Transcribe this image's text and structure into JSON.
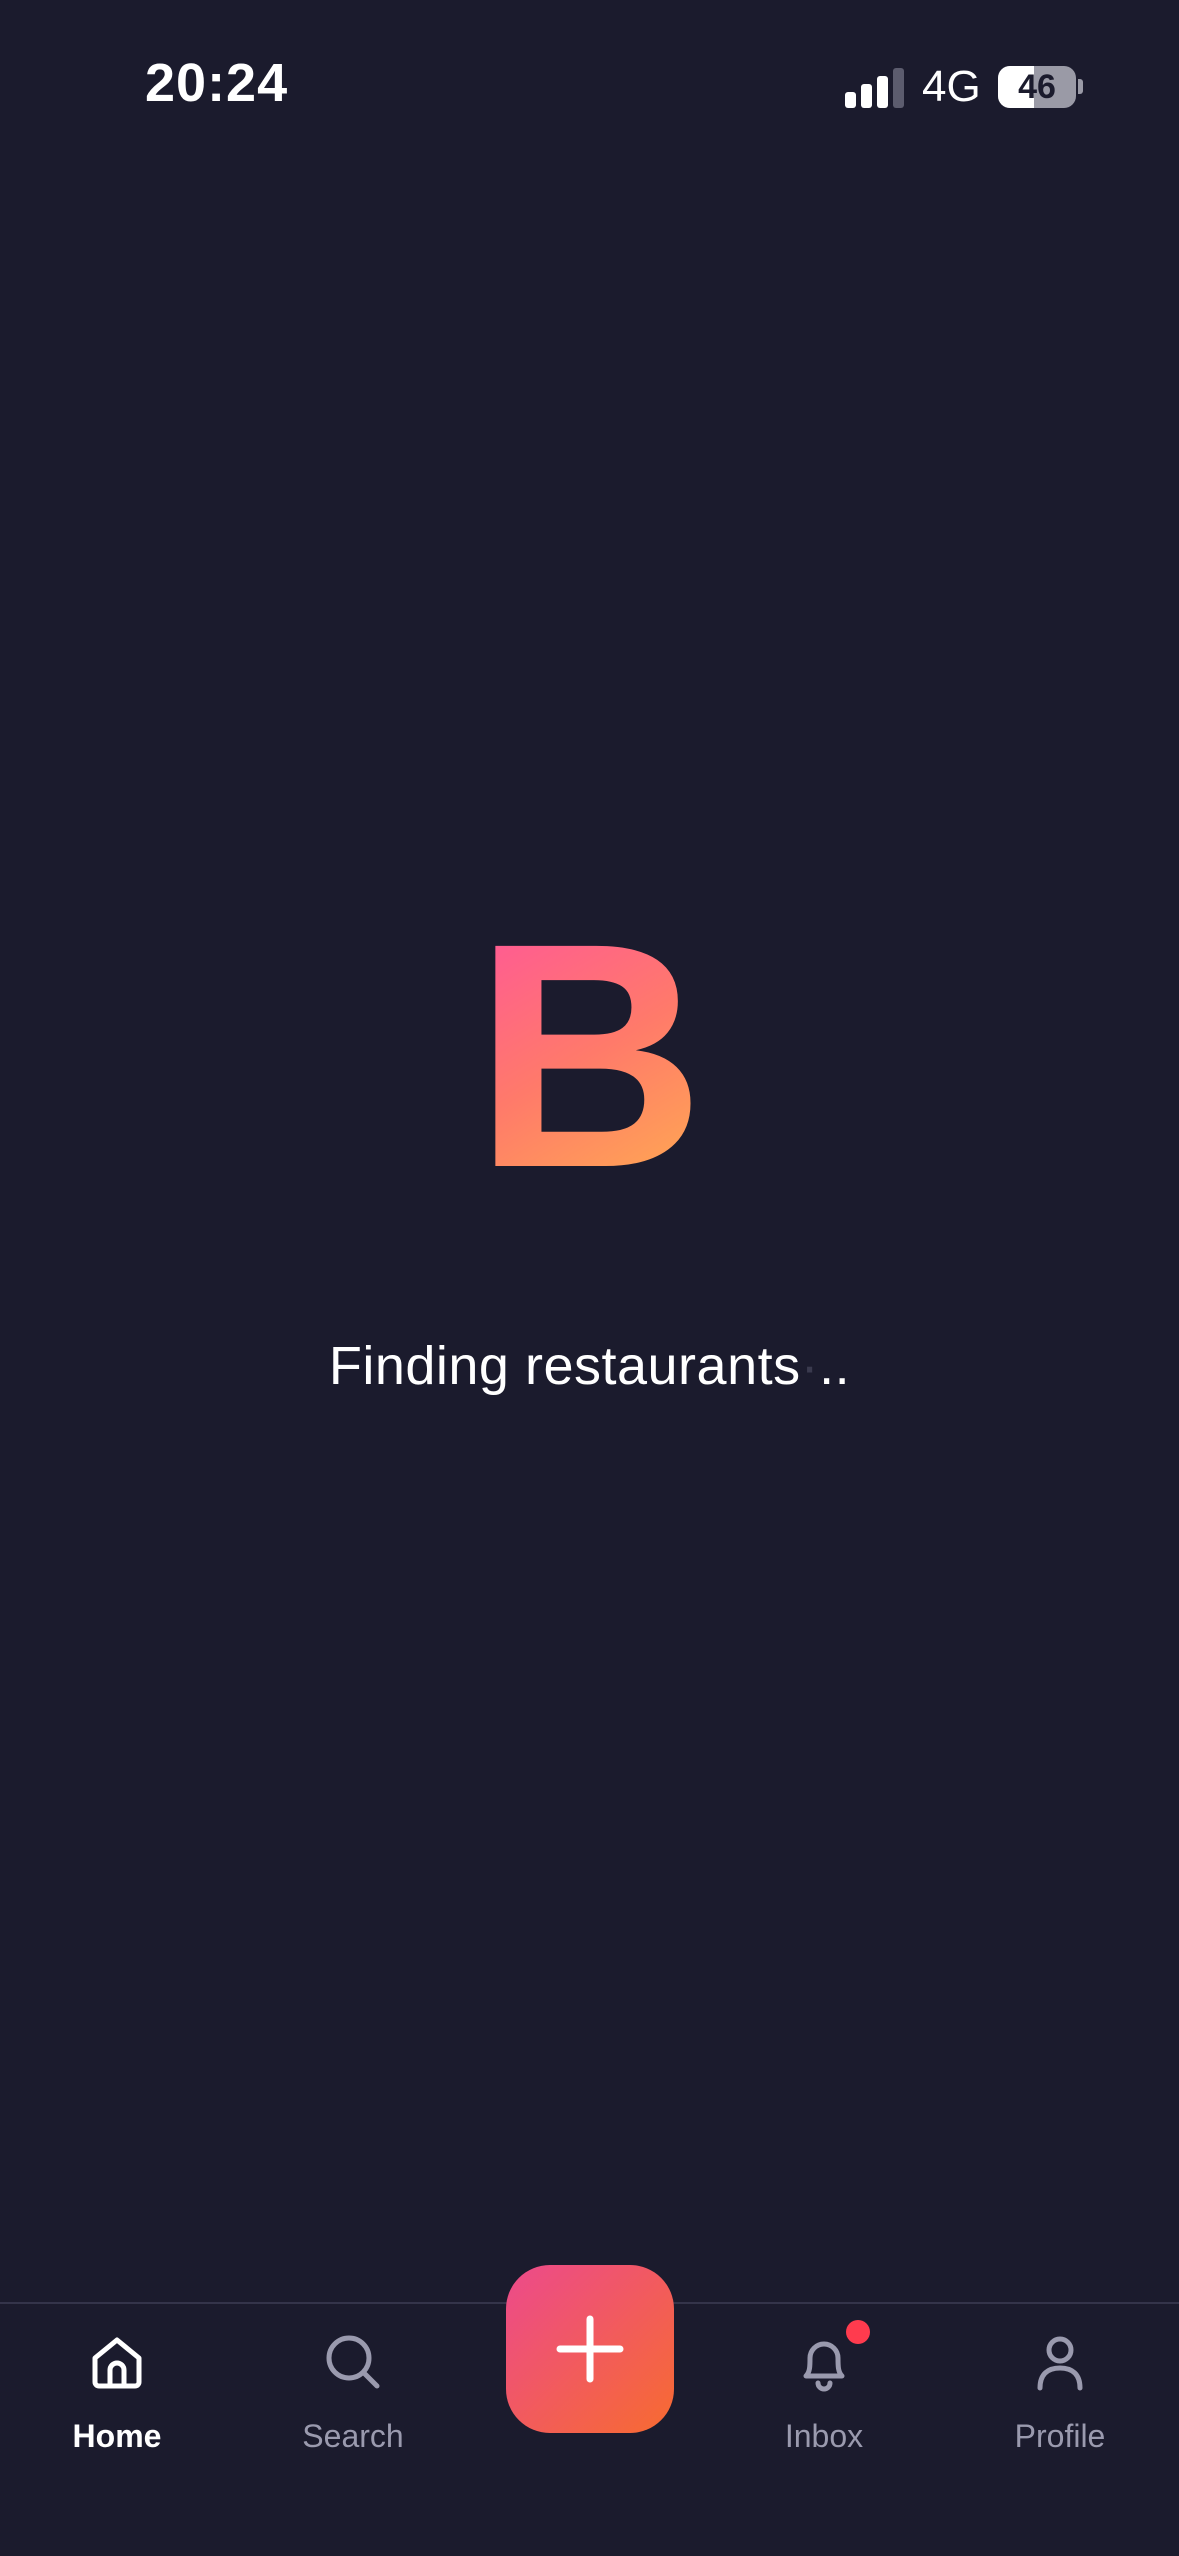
{
  "status_bar": {
    "time": "20:24",
    "network": "4G",
    "battery_level": "46",
    "battery_fraction": 0.46
  },
  "loader": {
    "logo_letter": "B",
    "message": "Finding restaurants",
    "ellipsis": [
      "·",
      ".",
      "."
    ]
  },
  "colors": {
    "background": "#1b1b2d",
    "logo_gradient": [
      "#ff4fa3",
      "#ffb84a"
    ],
    "fab_gradient": [
      "#ec4a8c",
      "#f76b30"
    ],
    "notification_dot": "#ff3b4e"
  },
  "tab_bar": {
    "items": [
      {
        "label": "Home",
        "icon": "home-icon",
        "active": true
      },
      {
        "label": "Search",
        "icon": "search-icon",
        "active": false
      },
      {
        "label": "Inbox",
        "icon": "bell-icon",
        "active": false,
        "badge": true
      },
      {
        "label": "Profile",
        "icon": "person-icon",
        "active": false
      }
    ],
    "fab_icon": "plus-icon"
  }
}
